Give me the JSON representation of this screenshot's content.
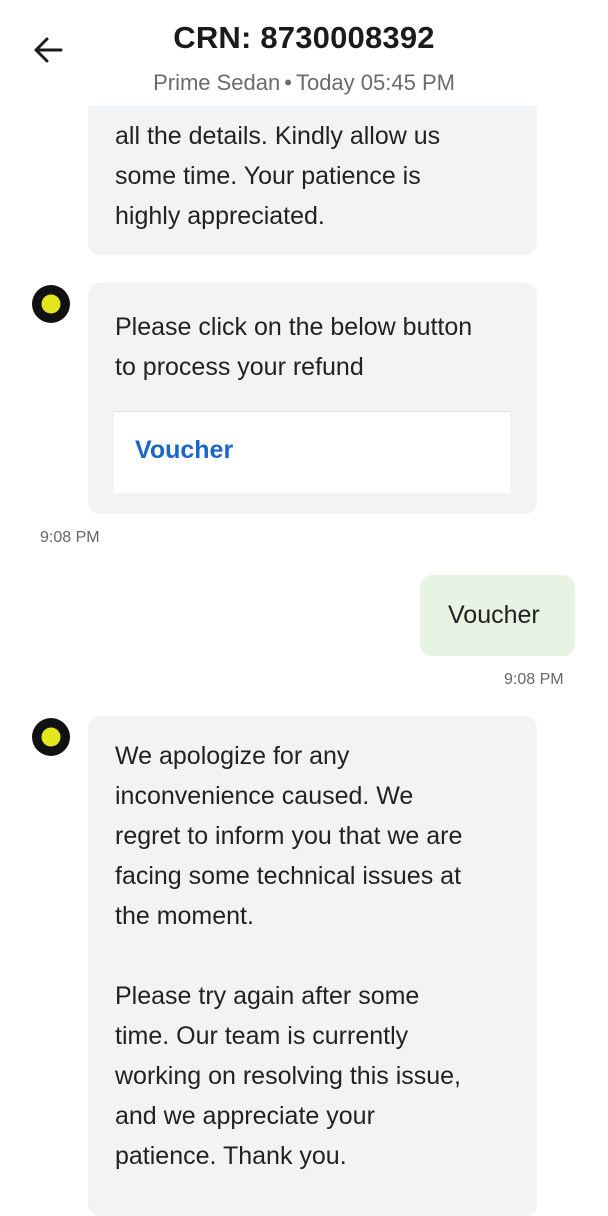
{
  "header": {
    "title": "CRN: 8730008392",
    "car_type": "Prime Sedan",
    "separator": "•",
    "booking_time": "Today 05:45 PM"
  },
  "messages": {
    "bot_1_partial": {
      "text": "all the details. Kindly allow us\nsome time. Your patience is\nhighly appreciated."
    },
    "bot_2": {
      "text": "Please click on the below button\nto process your refund",
      "button_label": "Voucher",
      "time": "9:08 PM"
    },
    "user_1": {
      "text": "Voucher",
      "time": "9:08 PM"
    },
    "bot_3": {
      "text": "We apologize for any\ninconvenience caused. We\nregret to inform you that we are\nfacing some technical issues at\nthe moment.\n\nPlease try again after some\ntime. Our team is currently\nworking on resolving this issue,\nand we appreciate your\npatience. Thank you."
    }
  },
  "icons": {
    "back": "arrow-left-icon",
    "bot_avatar": "bot-avatar-icon"
  },
  "colors": {
    "bot_bubble": "#f2f3f5",
    "user_bubble": "#e7f4e3",
    "link_blue": "#1a66c9",
    "avatar_yellow": "#e3e61d"
  }
}
